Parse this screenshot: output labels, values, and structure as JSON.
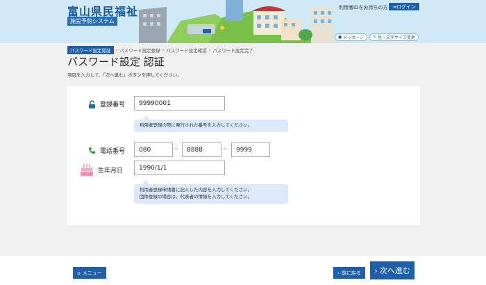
{
  "header": {
    "site_title": "富山県民福祉公園",
    "site_subtitle": "施設予約システム",
    "login_help_link": "利用者IDをお持ちの方",
    "login_button": "ログイン",
    "message_button": "メッセージ",
    "display_settings_button": "色・文字サイズ変更"
  },
  "breadcrumb": {
    "items": [
      "パスワード設定認証",
      "パスワード設定登録",
      "パスワード設定確認",
      "パスワード設定完了"
    ]
  },
  "page": {
    "title": "パスワード設定 認証",
    "instruction": "項目を入力して、「次へ進む」ボタンを押してください。"
  },
  "form": {
    "registration_number": {
      "label": "登録番号",
      "value": "99990001",
      "hint": "利用者登録の際に発行された番号を入力してください。"
    },
    "phone": {
      "label": "電話番号",
      "part1": "080",
      "part2": "8888",
      "part3": "9999",
      "separator": "-"
    },
    "birthdate": {
      "label": "生年月日",
      "value": "1990/1/1",
      "hint_line1": "利用者登録申請書に記入した内容を入力してください。",
      "hint_line2": "団体登録の場合は、代表者の情報を入力してください。"
    }
  },
  "footer": {
    "menu_button": "メニュー",
    "back_button": "前に戻る",
    "next_button": "次へ進む"
  },
  "colors": {
    "primary": "#1e5fa8",
    "header_bg": "#cfe9f7",
    "hint_bg": "#dce9f8",
    "lock_icon": "#2a6cb0",
    "phone_icon": "#2e9a3e",
    "cake_icon": "#f08fb0"
  }
}
